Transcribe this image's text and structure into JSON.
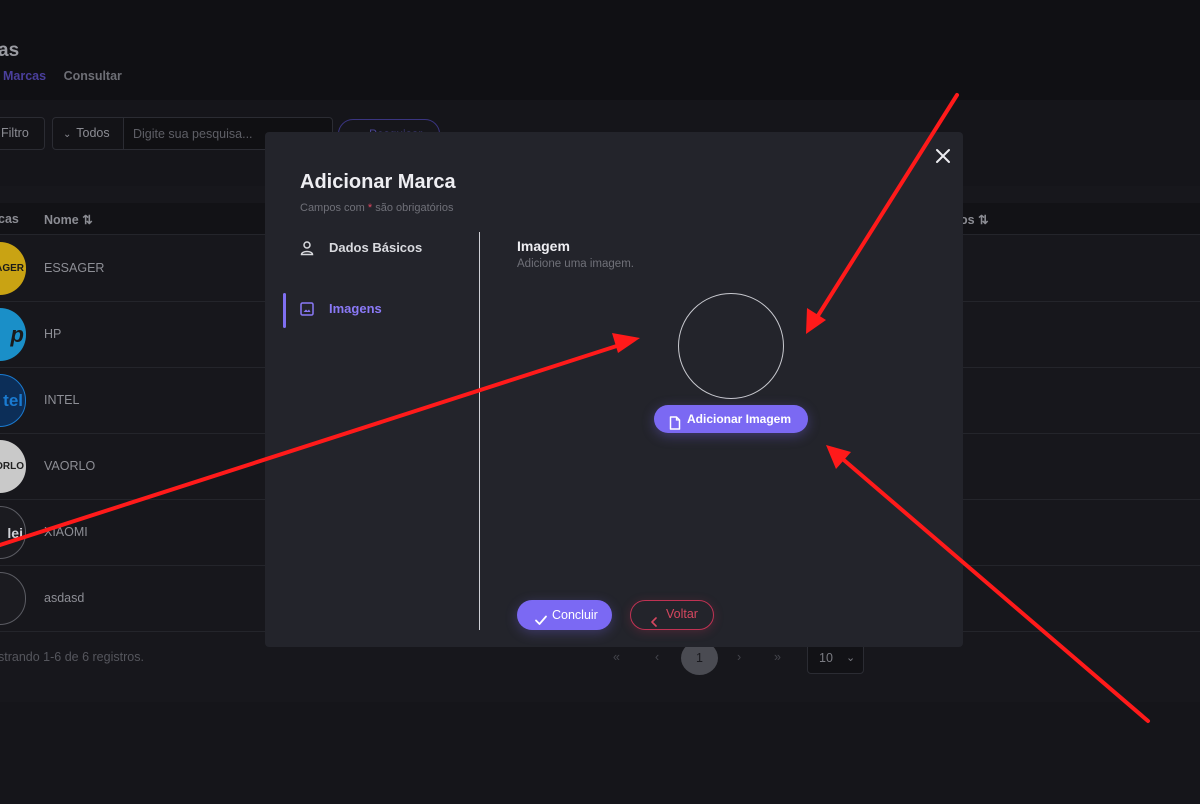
{
  "page": {
    "title": "as",
    "breadcrumb": {
      "link": "Marcas",
      "current": "Consultar"
    }
  },
  "toolbar": {
    "filter_label": "Filtro",
    "scope_label": "Todos",
    "search_placeholder": "Digite sua pesquisa...",
    "search_button": "Pesquisar"
  },
  "table": {
    "headers": {
      "brand": "cas",
      "name": "Nome",
      "status": "os"
    },
    "rows": [
      {
        "name": "ESSAGER",
        "logo_text": "AGER",
        "logo_bg": "#c9a313",
        "logo_color": "#1a1a1a"
      },
      {
        "name": "HP",
        "logo_text": "p",
        "logo_bg": "#1a8fc8",
        "logo_color": "#1a1a1a"
      },
      {
        "name": "INTEL",
        "logo_text": "tel",
        "logo_bg": "#0c2e58",
        "logo_color": "#1a7bd1"
      },
      {
        "name": "VAORLO",
        "logo_text": "ORLO",
        "logo_bg": "#c9c9c9",
        "logo_color": "#222222"
      },
      {
        "name": "XIAOMI",
        "logo_text": "lei",
        "logo_bg": "#1b1b20",
        "logo_color": "#cfd0d6"
      },
      {
        "name": "asdasd",
        "logo_text": "",
        "logo_bg": "#1b1b20",
        "logo_color": "#cfd0d6"
      }
    ],
    "footer": "strando 1-6 de 6 registros.",
    "pager": {
      "first": "«",
      "prev": "‹",
      "current": "1",
      "next": "›",
      "last": "»",
      "per_page": "10"
    }
  },
  "modal": {
    "title": "Adicionar Marca",
    "required_note_before": "Campos com ",
    "required_star": "*",
    "required_note_after": " são obrigatórios",
    "close_icon": "close-icon",
    "steps": [
      {
        "label": "Dados Básicos",
        "icon": "user-icon",
        "active": false
      },
      {
        "label": "Imagens",
        "icon": "image-icon",
        "active": true
      }
    ],
    "section": {
      "title": "Imagem",
      "subtitle": "Adicione uma imagem.",
      "add_button": "Adicionar Imagem"
    },
    "actions": {
      "conclude": "Concluir",
      "back": "Voltar"
    }
  },
  "colors": {
    "accent": "#7b69f3",
    "danger": "#c03253",
    "annotation": "#ff1a1a"
  }
}
